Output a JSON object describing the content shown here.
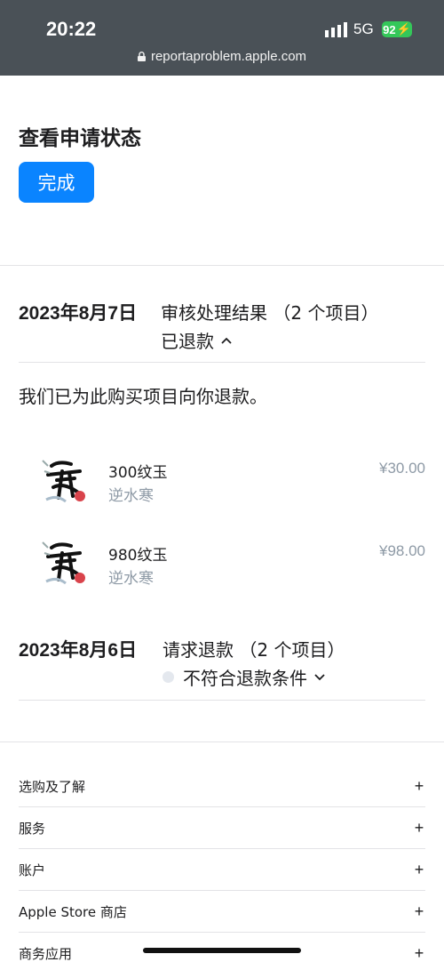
{
  "status_bar": {
    "time": "20:22",
    "network": "5G",
    "battery": "92"
  },
  "browser": {
    "url": "reportaproblem.apple.com"
  },
  "header": {
    "title": "查看申请状态",
    "done_label": "完成"
  },
  "sections": [
    {
      "date": "2023年8月7日",
      "title": "审核处理结果 （2 个项目）",
      "status": "已退款",
      "message": "我们已为此购买项目向你退款。",
      "items": [
        {
          "name": "300纹玉",
          "game": "逆水寒",
          "price": "¥30.00"
        },
        {
          "name": "980纹玉",
          "game": "逆水寒",
          "price": "¥98.00"
        }
      ]
    },
    {
      "date": "2023年8月6日",
      "title": "请求退款 （2 个项目）",
      "status": "不符合退款条件"
    }
  ],
  "footer": {
    "items": [
      {
        "label": "选购及了解",
        "icon": "plus-icon"
      },
      {
        "label": "服务",
        "icon": "plus-icon"
      },
      {
        "label": "账户",
        "icon": "plus-icon"
      },
      {
        "label": "Apple Store 商店",
        "icon": "plus-icon"
      },
      {
        "label": "商务应用",
        "icon": "plus-icon"
      }
    ]
  },
  "colors": {
    "accent": "#0a84ff",
    "topbar": "#4a5157",
    "battery": "#34c759",
    "muted": "#8e9aa6"
  }
}
